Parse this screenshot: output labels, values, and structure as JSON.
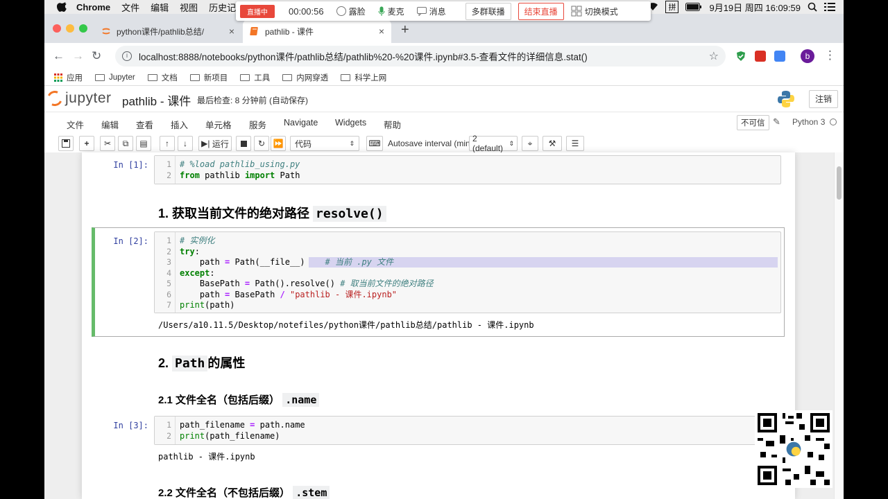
{
  "menubar": {
    "app": "Chrome",
    "items": [
      "文件",
      "编辑",
      "视图",
      "历史记"
    ],
    "clock": "9月19日 周四  16:09:59"
  },
  "live": {
    "badge": "直播中",
    "timer": "00:00:56",
    "beauty": "露脸",
    "mic": "麦克",
    "message": "消息",
    "multi": "多群联播",
    "end": "结束直播",
    "switch": "切换模式"
  },
  "browser": {
    "tabs": [
      {
        "title": "python课件/pathlib总结/"
      },
      {
        "title": "pathlib - 课件"
      }
    ],
    "url": "localhost:8888/notebooks/python课件/pathlib总结/pathlib%20-%20课件.ipynb#3.5-查看文件的详细信息.stat()",
    "profile": "b",
    "bookmarks": [
      "应用",
      "Jupyter",
      "文档",
      "新项目",
      "工具",
      "内网穿透",
      "科学上网"
    ]
  },
  "jupyter": {
    "logo_text": "jupyter",
    "notebook_name": "pathlib - 课件",
    "checkpoint": "最后检查: 8 分钟前  (自动保存)",
    "logout": "注销",
    "menu": [
      "文件",
      "编辑",
      "查看",
      "插入",
      "单元格",
      "服务",
      "Navigate",
      "Widgets",
      "帮助"
    ],
    "trusted": "不可信",
    "kernel": "Python 3",
    "toolbar": {
      "run": "运行",
      "cell_type": "代码",
      "autosave_label": "Autosave interval (min):",
      "autosave_value": "2 (default)"
    }
  },
  "cells": {
    "c1": {
      "prompt": "In [1]:"
    },
    "h1": {
      "text": "1. 获取当前文件的绝对路径",
      "code": "resolve()"
    },
    "c2": {
      "prompt": "In [2]:",
      "output": "/Users/a10.11.5/Desktop/notefiles/python课件/pathlib总结/pathlib - 课件.ipynb"
    },
    "h2": {
      "text": "的属性",
      "num": "2.",
      "code": "Path"
    },
    "h21": {
      "text": "2.1 文件全名（包括后缀）",
      "code": ".name"
    },
    "c3": {
      "prompt": "In [3]:",
      "output": "pathlib - 课件.ipynb"
    },
    "h22": {
      "text": "2.2 文件全名（不包括后缀）",
      "code": ".stem"
    }
  },
  "colors": {
    "selected_cell": "#66bb6a",
    "prompt": "#303f9f",
    "live_red": "#e8483b",
    "jupyter_orange": "#f37626"
  }
}
